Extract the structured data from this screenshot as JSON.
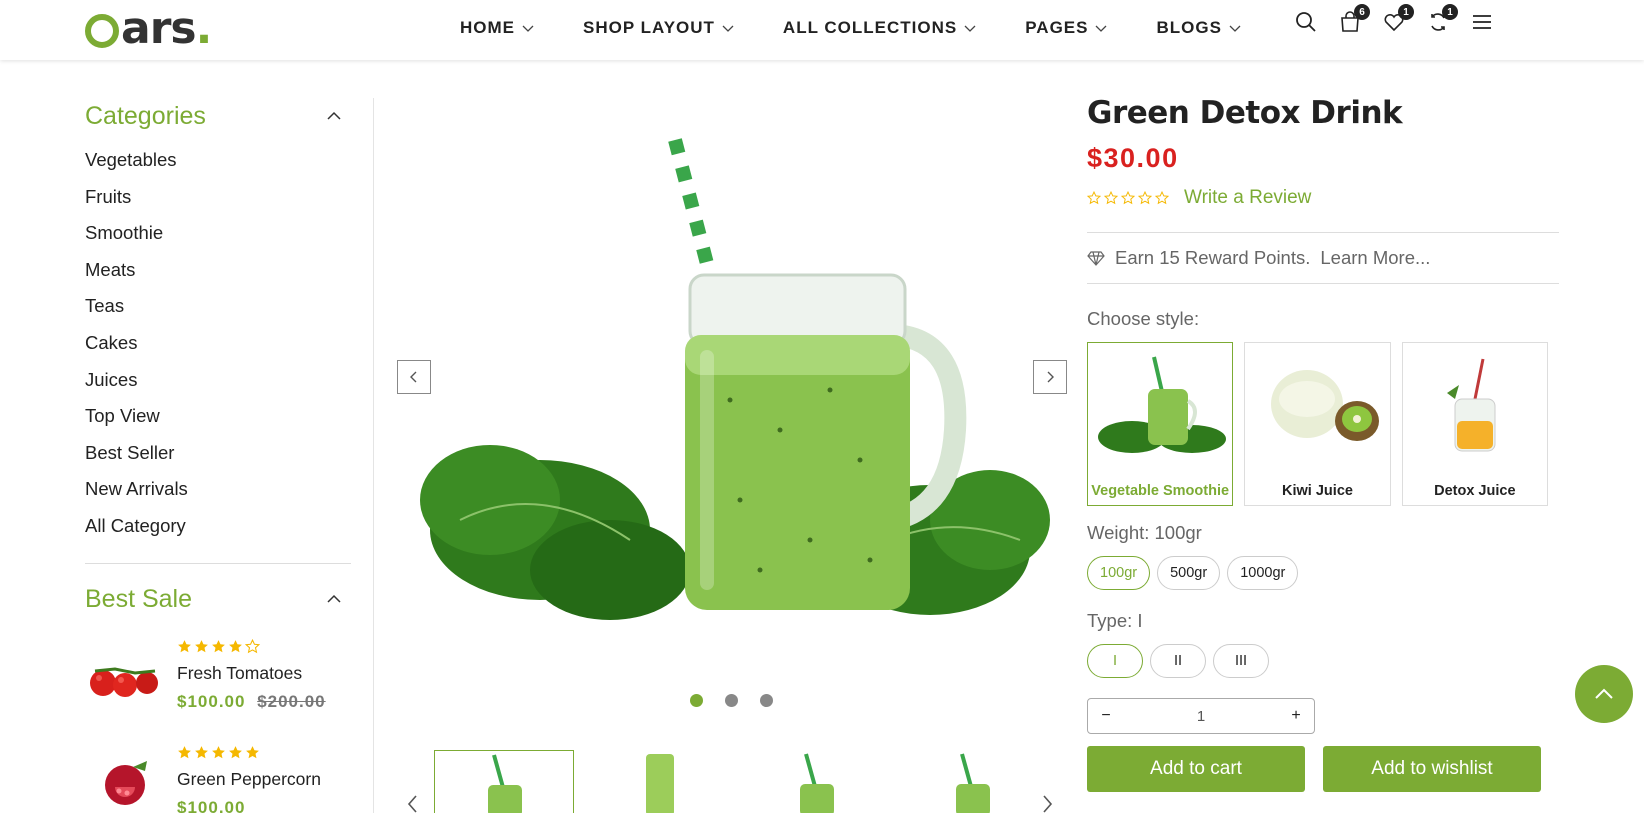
{
  "brand": {
    "name": "ars",
    "dot": "."
  },
  "nav": {
    "items": [
      {
        "label": "HOME"
      },
      {
        "label": "SHOP LAYOUT"
      },
      {
        "label": "ALL COLLECTIONS"
      },
      {
        "label": "PAGES"
      },
      {
        "label": "BLOGS"
      }
    ]
  },
  "header_icons": {
    "cart_count": "6",
    "wishlist_count": "1",
    "compare_count": "1"
  },
  "sidebar": {
    "categories_title": "Categories",
    "categories": [
      {
        "label": "Vegetables"
      },
      {
        "label": "Fruits"
      },
      {
        "label": "Smoothie"
      },
      {
        "label": "Meats"
      },
      {
        "label": "Teas"
      },
      {
        "label": "Cakes"
      },
      {
        "label": "Juices"
      },
      {
        "label": "Top View"
      },
      {
        "label": "Best Seller"
      },
      {
        "label": "New Arrivals"
      },
      {
        "label": "All Category"
      }
    ],
    "best_sale_title": "Best Sale",
    "best_sale": [
      {
        "name": "Fresh Tomatoes",
        "price": "$100.00",
        "old_price": "$200.00",
        "rating": 4
      },
      {
        "name": "Green Peppercorn",
        "price": "$100.00",
        "old_price": "",
        "rating": 5
      }
    ]
  },
  "gallery": {
    "slide_count": 3,
    "active_slide": 1
  },
  "product": {
    "title": "Green Detox Drink",
    "price": "$30.00",
    "rating": 0,
    "write_review": "Write a Review",
    "reward_text": "Earn 15 Reward Points.",
    "learn_more": "Learn More...",
    "choose_style_label": "Choose style:",
    "styles": [
      {
        "name": "Vegetable Smoothie",
        "selected": true
      },
      {
        "name": "Kiwi Juice",
        "selected": false
      },
      {
        "name": "Detox Juice",
        "selected": false
      }
    ],
    "weight_label": "Weight: 100gr",
    "weights": [
      {
        "label": "100gr",
        "selected": true
      },
      {
        "label": "500gr",
        "selected": false
      },
      {
        "label": "1000gr",
        "selected": false
      }
    ],
    "type_label": "Type: I",
    "types": [
      {
        "label": "I",
        "selected": true
      },
      {
        "label": "II",
        "selected": false
      },
      {
        "label": "III",
        "selected": false
      }
    ],
    "quantity": "1",
    "qty_minus": "−",
    "qty_plus": "+",
    "add_to_cart": "Add to cart",
    "add_to_wishlist": "Add to wishlist"
  },
  "colors": {
    "accent": "#7cab34",
    "price_red": "#d9211f",
    "star_gold": "#f5b800"
  }
}
